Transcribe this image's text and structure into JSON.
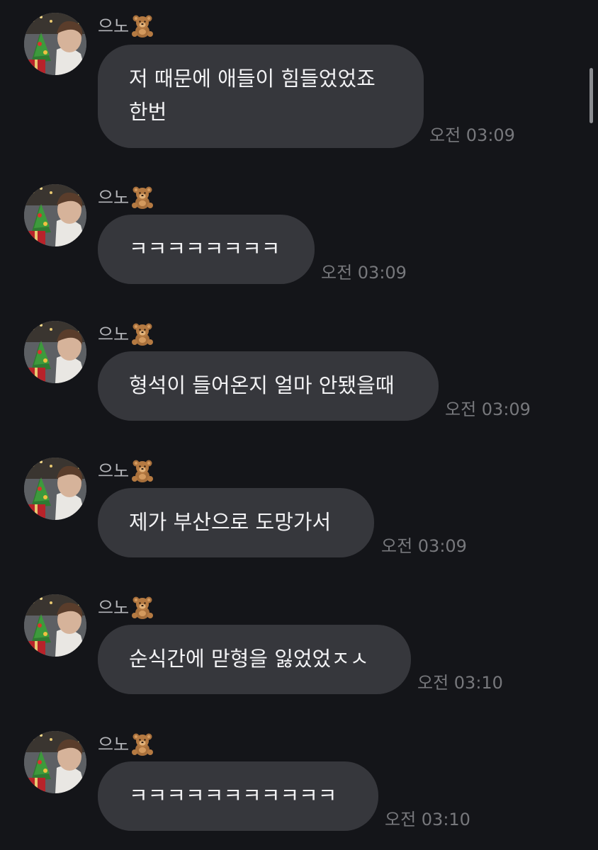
{
  "sender_name": "으노",
  "sender_icon": "teddy-bear-emoji-icon",
  "avatar_icon": "profile-photo-avatar",
  "messages": [
    {
      "lines": [
        "저 때문에 애들이 힘들었었죠",
        "한번"
      ],
      "time": "오전 03:09"
    },
    {
      "lines": [
        "ㅋㅋㅋㅋㅋㅋㅋㅋ"
      ],
      "time": "오전 03:09"
    },
    {
      "lines": [
        "형석이 들어온지 얼마 안됐을때"
      ],
      "time": "오전 03:09"
    },
    {
      "lines": [
        "제가 부산으로 도망가서"
      ],
      "time": "오전 03:09"
    },
    {
      "lines": [
        "순식간에 맏형을 잃었었ㅈㅅ"
      ],
      "time": "오전 03:10"
    },
    {
      "lines": [
        "ㅋㅋㅋㅋㅋㅋㅋㅋㅋㅋㅋ"
      ],
      "time": "오전 03:10"
    }
  ],
  "colors": {
    "background": "#141519",
    "bubble": "#36373c",
    "text": "#f2f2f4",
    "timestamp": "#77787c"
  }
}
